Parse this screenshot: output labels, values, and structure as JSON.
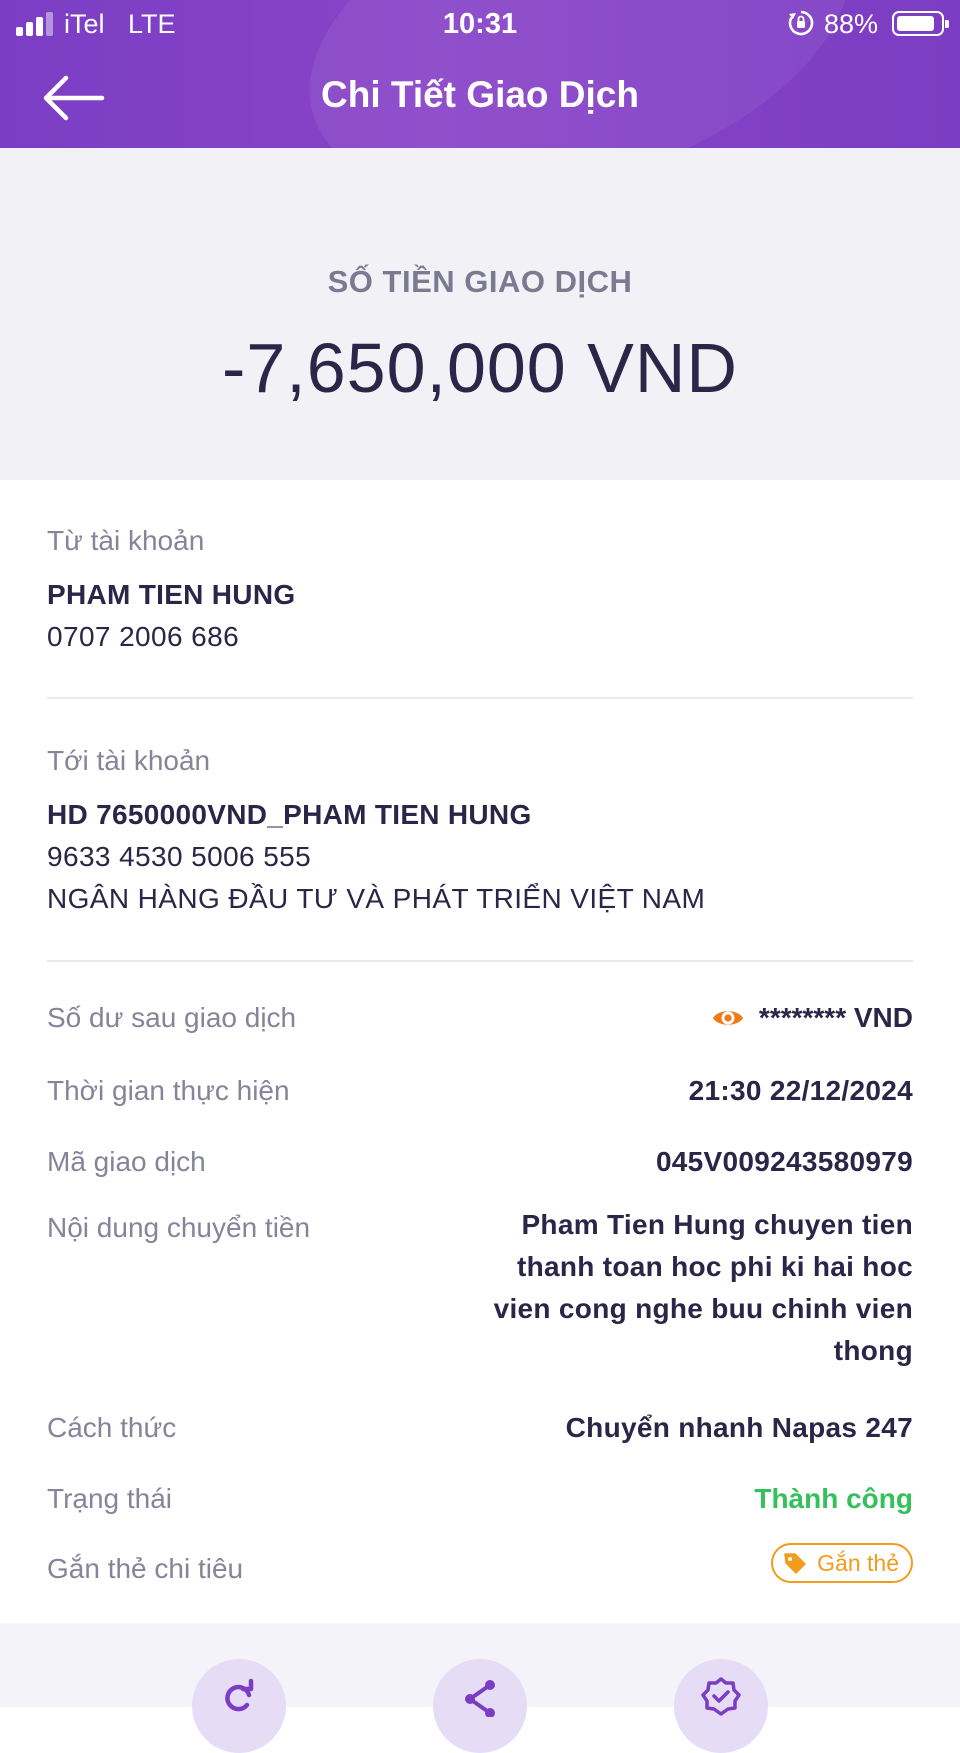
{
  "status_bar": {
    "carrier": "iTel",
    "network": "LTE",
    "time": "10:31",
    "battery_percent": "88%",
    "battery_level": 0.88
  },
  "nav": {
    "title": "Chi Tiết Giao Dịch",
    "back_icon": "arrow-left-icon"
  },
  "amount": {
    "label": "SỐ TIỀN GIAO DỊCH",
    "value": "-7,650,000 VND"
  },
  "from_account": {
    "label": "Từ tài khoản",
    "name": "PHAM TIEN HUNG",
    "number": "0707 2006 686"
  },
  "to_account": {
    "label": "Tới tài khoản",
    "name": "HD 7650000VND_PHAM TIEN HUNG",
    "number": "9633 4530 5006 555",
    "bank": "NGÂN HÀNG ĐẦU TƯ VÀ PHÁT TRIỂN VIỆT NAM"
  },
  "details": {
    "balance_label": "Số dư sau giao dịch",
    "balance_value": "******** VND",
    "time_label": "Thời gian thực hiện",
    "time_value": "21:30 22/12/2024",
    "txn_id_label": "Mã giao dịch",
    "txn_id_value": "045V009243580979",
    "note_label": "Nội dung chuyển tiền",
    "note_value": "Pham Tien Hung chuyen tien thanh toan hoc phi ki hai hoc vien cong nghe buu chinh vien thong",
    "method_label": "Cách thức",
    "method_value": "Chuyển nhanh Napas 247",
    "status_label": "Trạng thái",
    "status_value": "Thành công",
    "tag_label": "Gắn thẻ chi tiêu",
    "tag_button": "Gắn thẻ"
  },
  "colors": {
    "header": "#8a44c8",
    "accent_orange": "#f29b1c",
    "success_green": "#34c05a",
    "text_dark": "#2b2548",
    "text_muted": "#858499"
  },
  "actions": [
    {
      "icon": "repeat-icon"
    },
    {
      "icon": "share-icon"
    },
    {
      "icon": "verified-badge-icon"
    }
  ]
}
